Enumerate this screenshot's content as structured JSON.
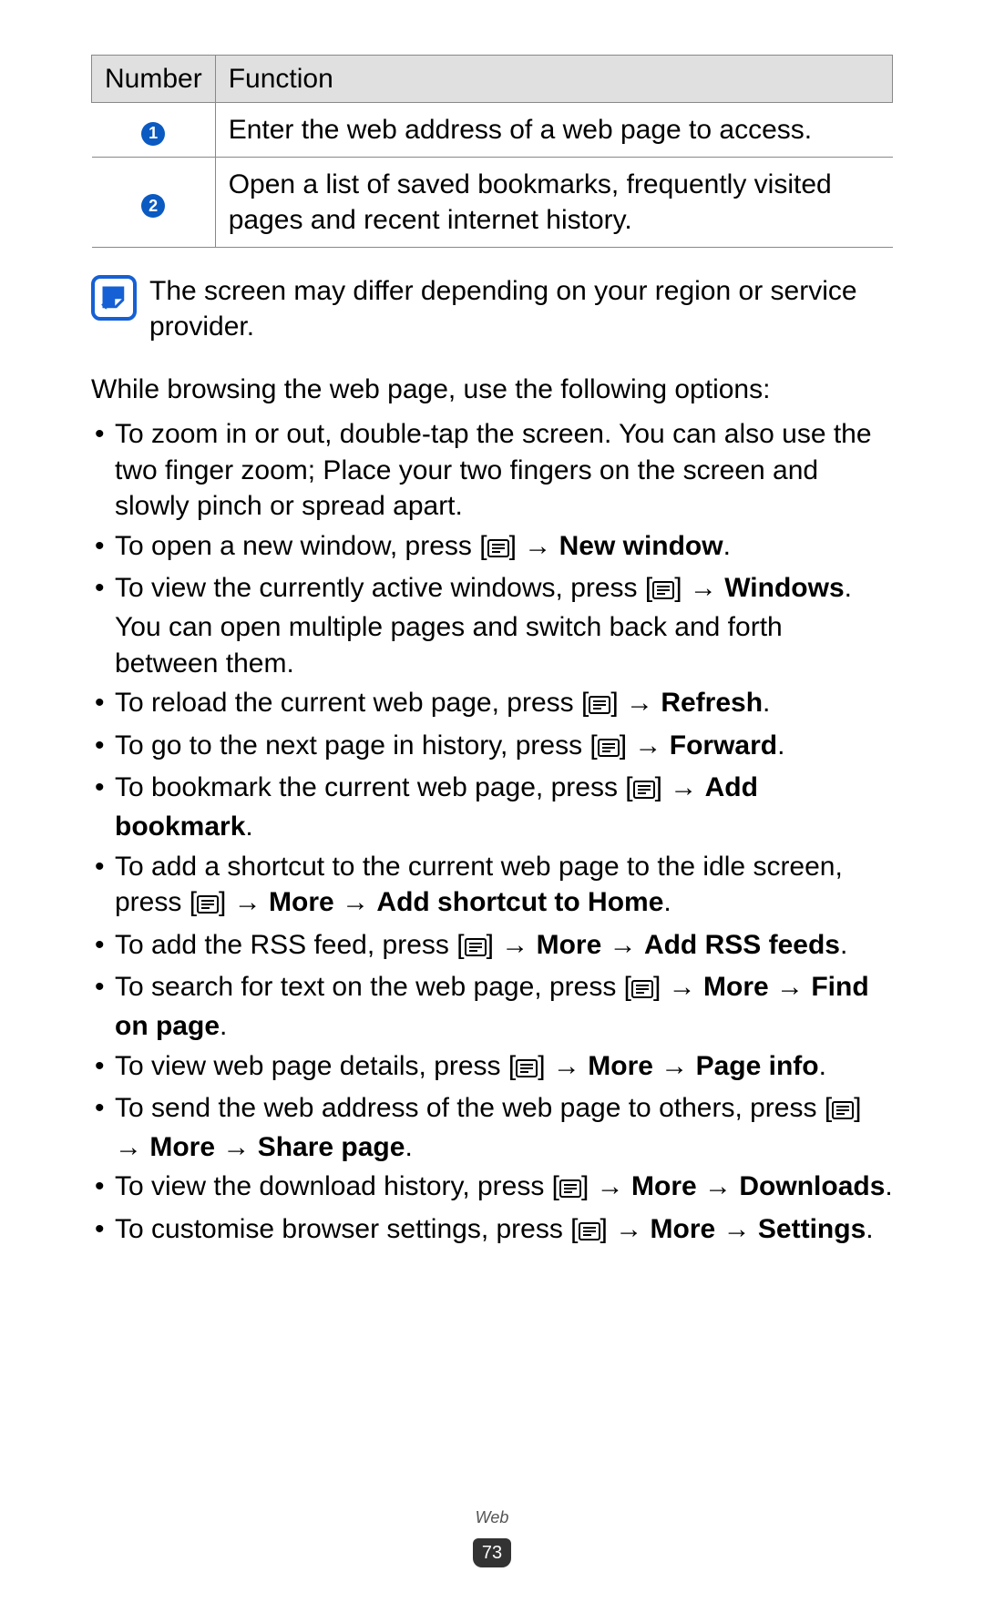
{
  "table": {
    "headers": {
      "col1": "Number",
      "col2": "Function"
    },
    "rows": [
      {
        "num": "1",
        "func": "Enter the web address of a web page to access."
      },
      {
        "num": "2",
        "func": "Open a list of saved bookmarks, frequently visited pages and recent internet history."
      }
    ]
  },
  "note": "The screen may differ depending on your region or service provider.",
  "intro": "While browsing the web page, use the following options:",
  "items": [
    {
      "segments": [
        {
          "t": "To zoom in or out, double-tap the screen. You can also use the two finger zoom; Place your two fingers on the screen and slowly pinch or spread apart."
        }
      ]
    },
    {
      "segments": [
        {
          "t": "To open a new window, press ["
        },
        {
          "icon": true
        },
        {
          "t": "] → "
        },
        {
          "t": "New window",
          "b": true
        },
        {
          "t": "."
        }
      ]
    },
    {
      "segments": [
        {
          "t": "To view the currently active windows, press ["
        },
        {
          "icon": true
        },
        {
          "t": "] → "
        },
        {
          "t": "Windows",
          "b": true
        },
        {
          "t": ". You can open multiple pages and switch back and forth between them."
        }
      ]
    },
    {
      "segments": [
        {
          "t": "To reload the current web page, press ["
        },
        {
          "icon": true
        },
        {
          "t": "] → "
        },
        {
          "t": "Refresh",
          "b": true
        },
        {
          "t": "."
        }
      ]
    },
    {
      "segments": [
        {
          "t": "To go to the next page in history, press ["
        },
        {
          "icon": true
        },
        {
          "t": "] → "
        },
        {
          "t": "Forward",
          "b": true
        },
        {
          "t": "."
        }
      ]
    },
    {
      "segments": [
        {
          "t": "To bookmark the current web page, press ["
        },
        {
          "icon": true
        },
        {
          "t": "] → "
        },
        {
          "t": "Add bookmark",
          "b": true
        },
        {
          "t": "."
        }
      ]
    },
    {
      "segments": [
        {
          "t": "To add a shortcut to the current web page to the idle screen, press ["
        },
        {
          "icon": true
        },
        {
          "t": "] → "
        },
        {
          "t": "More",
          "b": true
        },
        {
          "t": " → "
        },
        {
          "t": "Add shortcut to Home",
          "b": true
        },
        {
          "t": "."
        }
      ]
    },
    {
      "segments": [
        {
          "t": "To add the RSS feed, press ["
        },
        {
          "icon": true
        },
        {
          "t": "] → "
        },
        {
          "t": "More",
          "b": true
        },
        {
          "t": " → "
        },
        {
          "t": "Add RSS feeds",
          "b": true
        },
        {
          "t": "."
        }
      ]
    },
    {
      "segments": [
        {
          "t": "To search for text on the web page, press ["
        },
        {
          "icon": true
        },
        {
          "t": "] → "
        },
        {
          "t": "More",
          "b": true
        },
        {
          "t": " → "
        },
        {
          "t": "Find on page",
          "b": true
        },
        {
          "t": "."
        }
      ]
    },
    {
      "segments": [
        {
          "t": "To view web page details, press ["
        },
        {
          "icon": true
        },
        {
          "t": "] → "
        },
        {
          "t": "More",
          "b": true
        },
        {
          "t": " → "
        },
        {
          "t": "Page info",
          "b": true
        },
        {
          "t": "."
        }
      ]
    },
    {
      "segments": [
        {
          "t": "To send the web address of the web page to others, press ["
        },
        {
          "icon": true
        },
        {
          "t": "] → "
        },
        {
          "t": "More",
          "b": true
        },
        {
          "t": " → "
        },
        {
          "t": "Share page",
          "b": true
        },
        {
          "t": "."
        }
      ]
    },
    {
      "segments": [
        {
          "t": "To view the download history, press ["
        },
        {
          "icon": true
        },
        {
          "t": "] → "
        },
        {
          "t": "More",
          "b": true
        },
        {
          "t": " → "
        },
        {
          "t": "Downloads",
          "b": true
        },
        {
          "t": "."
        }
      ]
    },
    {
      "segments": [
        {
          "t": "To customise browser settings, press ["
        },
        {
          "icon": true
        },
        {
          "t": "] → "
        },
        {
          "t": "More",
          "b": true
        },
        {
          "t": " → "
        },
        {
          "t": "Settings",
          "b": true
        },
        {
          "t": "."
        }
      ]
    }
  ],
  "footer": {
    "section": "Web",
    "page": "73"
  }
}
